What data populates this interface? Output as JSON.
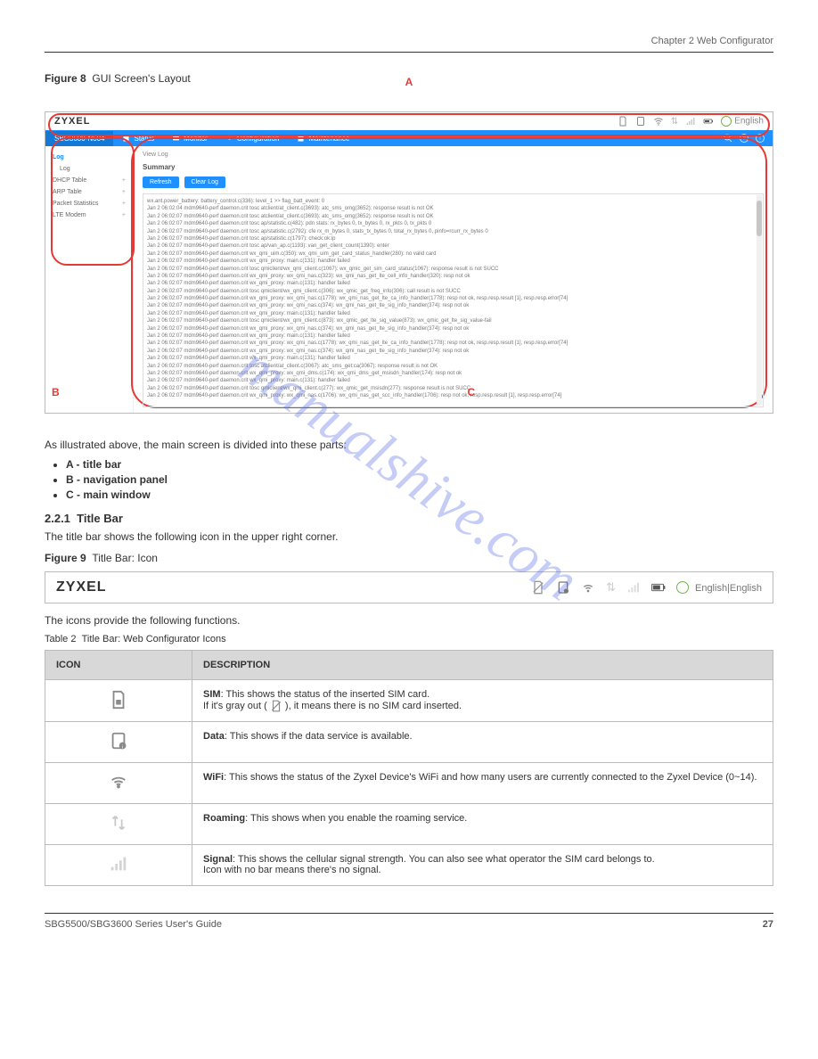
{
  "header_right": "Chapter 2 Web Configurator",
  "sec1_label": "Figure 8",
  "sec1_title": "GUI Screen's Layout",
  "shot": {
    "brand": "ZYXEL",
    "lang": "English",
    "device": "SBG3600-N604",
    "tabs": [
      "Status",
      "Monitor",
      "Configuration",
      "Maintenance"
    ],
    "right_icons": [
      "search-icon",
      "help-icon",
      "info-icon"
    ],
    "sidebar": [
      {
        "label": "Log",
        "sel": true,
        "expand": false
      },
      {
        "label": "Log",
        "sel": false,
        "child": true
      },
      {
        "label": "DHCP Table",
        "expand": true
      },
      {
        "label": "ARP Table",
        "expand": true
      },
      {
        "label": "Packet Statistics",
        "expand": true
      },
      {
        "label": "LTE Modem",
        "expand": true
      }
    ],
    "crumb": "View Log",
    "summary": "Summary",
    "btn_refresh": "Refresh",
    "btn_clear": "Clear Log",
    "loglines": [
      "wx.ant.power_battery: battery_control.c(336): level_1 >> flag_batt_event: 0",
      "Jan  2 06:02:04 mdm9640-perf daemon.crit tosc atclient/at_client.c(3693): atc_sms_omg(3652): response result is not OK",
      "Jan  2 06:02:07 mdm9640-perf daemon.crit tosc atclient/at_client.c(3693): atc_sms_omg(3652): response result is not OK",
      "Jan  2 06:02:07 mdm9640-perf daemon.crit tosc ap/statistic.c(482): pdn stats: rx_bytes 0, tx_bytes 0, rx_pkts 0, tx_pkts 0",
      "Jan  2 06:02:07 mdm9640-perf daemon.crit tosc ap/statistic.c(2792): cfe rx_m_bytes 0, stats_tx_bytes 0, total_rx_bytes 0, pinfo=rcurr_rx_bytes 0",
      "Jan  2 06:02:07 mdm9640-perf daemon.crit tosc ap/statistic.c(1797): check:ok:ip",
      "Jan  2 06:02:07 mdm9640-perf daemon.crit tosc ap/van_ap.c(1193): van_get_client_count(1390): enter",
      "Jan  2 06:02:07 mdm9640-perf daemon.crit wx_qmi_uim.c(350): wx_qmi_uim_get_card_status_handler(280): no valid card",
      "Jan  2 06:02:07 mdm9640-perf daemon.crit wx_qmi_proxy: main.c(131): handler failed",
      "Jan  2 06:02:07 mdm9640-perf daemon.crit tosc qmiclient/wx_qmi_client.c(1067): wx_qmic_get_sim_card_status(1067): response result is not SUCC",
      "Jan  2 06:02:07 mdm9640-perf daemon.crit wx_qmi_proxy: wx_qmi_nas.c(323): wx_qmi_nas_get_lte_cell_info_handler(320): resp not ok",
      "Jan  2 06:02:07 mdm9640-perf daemon.crit wx_qmi_proxy: main.c(131): handler failed",
      "Jan  2 06:02:07 mdm9640-perf daemon.crit tosc qmiclient/wx_qmi_client.c(306): wx_qmic_get_freq_info(306): call result is not SUCC",
      "Jan  2 06:02:07 mdm9640-perf daemon.crit wx_qmi_proxy: wx_qmi_nas.c(1778): wx_qmi_nas_get_lte_ca_info_handler(1778): resp not ok, resp.resp.result [1], resp.resp.error[74]",
      "Jan  2 06:02:07 mdm9640-perf daemon.crit wx_qmi_proxy: wx_qmi_nas.c(374): wx_qmi_nas_get_lte_sig_info_handler(374): resp not ok",
      "Jan  2 06:02:07 mdm9640-perf daemon.crit wx_qmi_proxy: main.c(131): handler failed",
      "Jan  2 06:02:07 mdm9640-perf daemon.crit tosc qmiclient/wx_qmi_client.c(873): wx_qmic_get_lte_sig_value(873): wx_qmic_get_lte_sig_value-fail",
      "Jan  2 06:02:07 mdm9640-perf daemon.crit wx_qmi_proxy: wx_qmi_nas.c(374): wx_qmi_nas_get_lte_sig_info_handler(374): resp not ok",
      "Jan  2 06:02:07 mdm9640-perf daemon.crit wx_qmi_proxy: main.c(131): handler failed",
      "Jan  2 06:02:07 mdm9640-perf daemon.crit wx_qmi_proxy: wx_qmi_nas.c(1778): wx_qmi_nas_get_lte_ca_info_handler(1778): resp not ok, resp.resp.result [1], resp.resp.error[74]",
      "Jan  2 06:02:07 mdm9640-perf daemon.crit wx_qmi_proxy: wx_qmi_nas.c(374): wx_qmi_nas_get_lte_sig_info_handler(374): resp not ok",
      "Jan  2 06:02:07 mdm9640-perf daemon.crit wx_qmi_proxy: main.c(131): handler failed",
      "Jan  2 06:02:07 mdm9640-perf daemon.crit tosc atclient/at_client.c(3067): atc_sms_get:ca(3067): response result is not OK",
      "Jan  2 06:02:07 mdm9640-perf daemon.crit wx_qmi_proxy: wx_qmi_dms.c(174): wx_qmi_dms_get_msisdn_handler(174): resp not ok",
      "Jan  2 06:02:07 mdm9640-perf daemon.crit wx_qmi_proxy: main.c(131): handler failed",
      "Jan  2 06:02:07 mdm9640-perf daemon.crit tosc qmiclient/wx_qmi_client.c(277): wx_qmic_get_msisdn(277): response result is not SUCC",
      "Jan  2 06:02:07 mdm9640-perf daemon.crit wx_qmi_proxy: wx_qmi_nas.c(1706): wx_qmi_nas_get_scc_info_handler(1706): resp not ok, resp.resp.result [1], resp.resp.error[74]"
    ],
    "callouts": {
      "A": "A",
      "B": "B",
      "C": "C"
    }
  },
  "para1": "As illustrated above, the main screen is divided into these parts:",
  "bullets": [
    "A - title bar",
    "B - navigation panel",
    "C - main window"
  ],
  "sec2_num": "2.2.1",
  "sec2_title": "Title Bar",
  "para2": "The title bar shows the following icon in the upper right corner.",
  "sec2_fig": "Figure 9",
  "sec2_figtitle": "Title Bar: Icon",
  "shot2": {
    "brand": "ZYXEL",
    "lang": "English|English"
  },
  "para3": "The icons provide the following functions.",
  "tbl_label": "Table 2",
  "tbl_title": "Title Bar: Web Configurator Icons",
  "tbl_head_icon": "ICON",
  "tbl_head_desc": "DESCRIPTION",
  "rows": [
    {
      "id": "sim-icon",
      "lines": [
        {
          "bold": "SIM",
          "rest": ": This shows the status of the inserted SIM card."
        },
        {
          "bold": "",
          "rest": "If it's gray out ( **slash** ), it means there is no SIM card inserted."
        }
      ]
    },
    {
      "id": "data-icon",
      "lines": [
        {
          "bold": "Data",
          "rest": ": This shows if the data service is available."
        }
      ]
    },
    {
      "id": "wifi-icon",
      "lines": [
        {
          "bold": "WiFi",
          "rest": ": This shows the status of the Zyxel Device's WiFi and how many users are currently connected to the Zyxel Device (0~14)."
        }
      ]
    },
    {
      "id": "roaming-icon",
      "lines": [
        {
          "bold": "Roaming",
          "rest": ": This shows when you enable the roaming service."
        }
      ]
    },
    {
      "id": "signal-icon",
      "lines": [
        {
          "bold": "Signal",
          "rest": ": This shows the cellular signal strength. You can also see what operator the SIM card belongs to."
        },
        {
          "bold": "",
          "rest": "Icon with no bar means there's no signal."
        }
      ]
    }
  ],
  "footer_left": "SBG5500/SBG3600 Series User's Guide",
  "footer_right": "27",
  "watermark": "manualshive.com"
}
